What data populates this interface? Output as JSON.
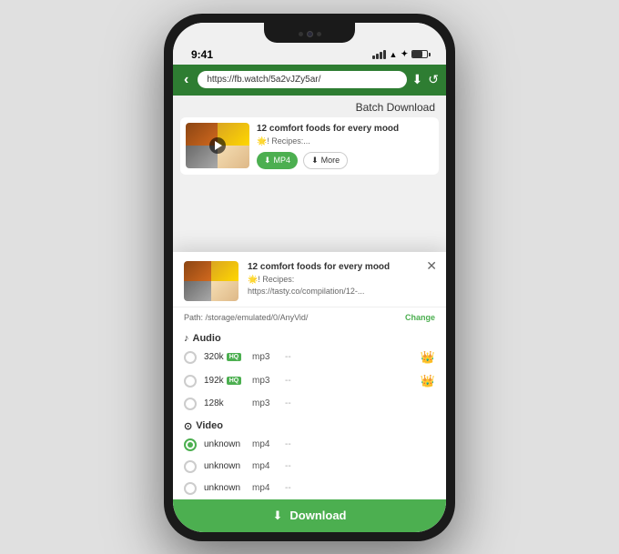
{
  "phone": {
    "time": "9:41",
    "signal": "●●●●",
    "bluetooth": "⚡",
    "battery_level": 70
  },
  "browser": {
    "back_icon": "‹",
    "url": "https://fb.watch/5a2vJZy5ar/",
    "download_icon": "⬇",
    "refresh_icon": "↺"
  },
  "batch_header": "Batch Download",
  "video_card": {
    "title": "12 comfort foods for every mood",
    "subtitle": "🌟! Recipes:...",
    "mp4_label": "MP4",
    "more_label": "More"
  },
  "modal": {
    "close_icon": "✕",
    "title": "12 comfort foods for every mood",
    "subtitle": "🌟! Recipes:",
    "url": "https://tasty.co/compilation/12-...",
    "path_label": "Path: /storage/emulated/0/AnyVid/",
    "change_label": "Change",
    "audio_section": "Audio",
    "video_section": "Video",
    "audio_options": [
      {
        "quality": "320k",
        "hq": true,
        "format": "mp3",
        "dash": "--",
        "premium": true
      },
      {
        "quality": "192k",
        "hq": true,
        "format": "mp3",
        "dash": "--",
        "premium": true
      },
      {
        "quality": "128k",
        "hq": false,
        "format": "mp3",
        "dash": "--",
        "premium": false
      }
    ],
    "video_options": [
      {
        "quality": "unknown",
        "format": "mp4",
        "dash": "--",
        "selected": true
      },
      {
        "quality": "unknown",
        "format": "mp4",
        "dash": "--",
        "selected": false
      },
      {
        "quality": "unknown",
        "format": "mp4",
        "dash": "--",
        "selected": false
      }
    ],
    "download_label": "Download"
  }
}
